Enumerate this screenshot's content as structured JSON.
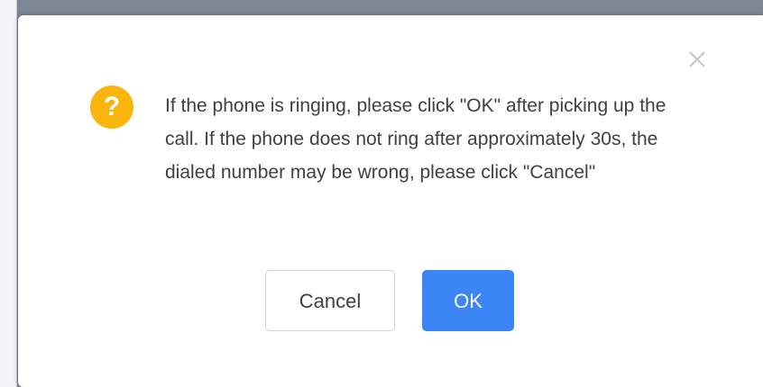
{
  "dialog": {
    "icon": "question-warning-icon",
    "message": "If the phone is ringing, please click \"OK\" after picking up the call. If the phone does not ring after approximately 30s, the dialed number may be wrong, please click \"Cancel\"",
    "close_icon": "close-icon",
    "buttons": {
      "cancel_label": "Cancel",
      "ok_label": "OK"
    }
  },
  "colors": {
    "warning": "#f9b50c",
    "primary": "#3c85f6",
    "text": "#404040"
  }
}
